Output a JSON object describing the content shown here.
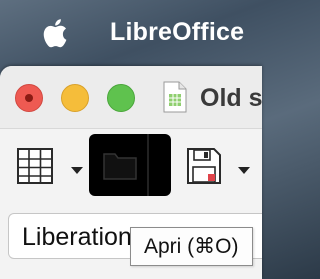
{
  "menubar": {
    "apple_icon": "apple-icon",
    "app_name": "LibreOffice"
  },
  "window": {
    "title": "Old s",
    "doc_icon": "spreadsheet-document-icon",
    "traffic_lights": {
      "close": "#ee5a52",
      "minimize": "#f5bd3a",
      "maximize": "#5fc24e"
    }
  },
  "toolbar": {
    "items": [
      {
        "icon": "table-grid-icon",
        "has_dropdown": true
      },
      {
        "icon": "folder-icon",
        "has_dropdown": true,
        "state": "hovered"
      },
      {
        "icon": "save-icon",
        "has_dropdown": true
      }
    ]
  },
  "format_bar": {
    "font_name": "Liberation Sans"
  },
  "tooltip": {
    "text": "Apri (⌘O)"
  }
}
